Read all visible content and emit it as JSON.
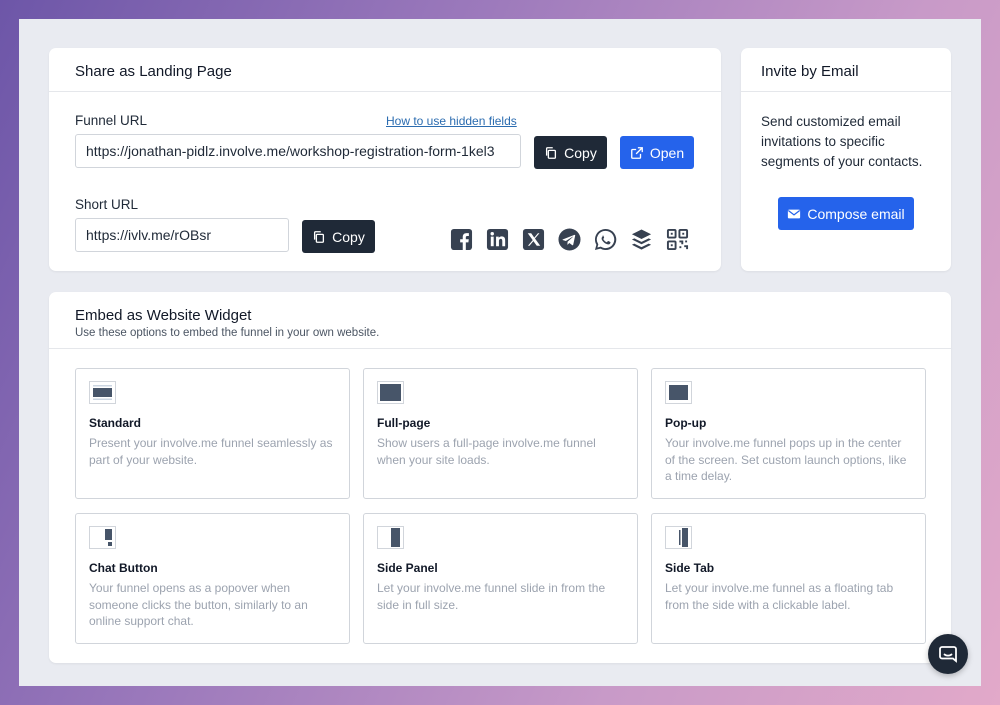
{
  "share": {
    "title": "Share as Landing Page",
    "funnel_url_label": "Funnel URL",
    "hidden_fields_link": "How to use hidden fields",
    "funnel_url_value": "https://jonathan-pidlz.involve.me/workshop-registration-form-1kel3",
    "copy_label": "Copy",
    "open_label": "Open",
    "short_url_label": "Short URL",
    "short_url_value": "https://ivlv.me/rOBsr",
    "short_copy_label": "Copy",
    "social_icons": [
      "facebook-icon",
      "linkedin-icon",
      "x-icon",
      "telegram-icon",
      "whatsapp-icon",
      "buffer-icon",
      "qr-code-icon"
    ]
  },
  "invite": {
    "title": "Invite by Email",
    "description": "Send customized email invitations to specific segments of your contacts.",
    "compose_label": "Compose email"
  },
  "embed": {
    "title": "Embed as Website Widget",
    "subtitle": "Use these options to embed the funnel in your own website.",
    "options": [
      {
        "title": "Standard",
        "description": "Present your involve.me funnel seamlessly as part of your website.",
        "icon": "standard-embed-icon"
      },
      {
        "title": "Full-page",
        "description": "Show users a full-page involve.me funnel when your site loads.",
        "icon": "full-page-embed-icon"
      },
      {
        "title": "Pop-up",
        "description": "Your involve.me funnel pops up in the center of the screen. Set custom launch options, like a time delay.",
        "icon": "popup-embed-icon"
      },
      {
        "title": "Chat Button",
        "description": "Your funnel opens as a popover when someone clicks the button, similarly to an online support chat.",
        "icon": "chat-button-embed-icon"
      },
      {
        "title": "Side Panel",
        "description": "Let your involve.me funnel slide in from the side in full size.",
        "icon": "side-panel-embed-icon"
      },
      {
        "title": "Side Tab",
        "description": "Let your involve.me funnel as a floating tab from the side with a clickable label.",
        "icon": "side-tab-embed-icon"
      }
    ]
  },
  "colors": {
    "accent": "#2563eb",
    "dark": "#1f2937",
    "muted": "#9ca3af"
  }
}
